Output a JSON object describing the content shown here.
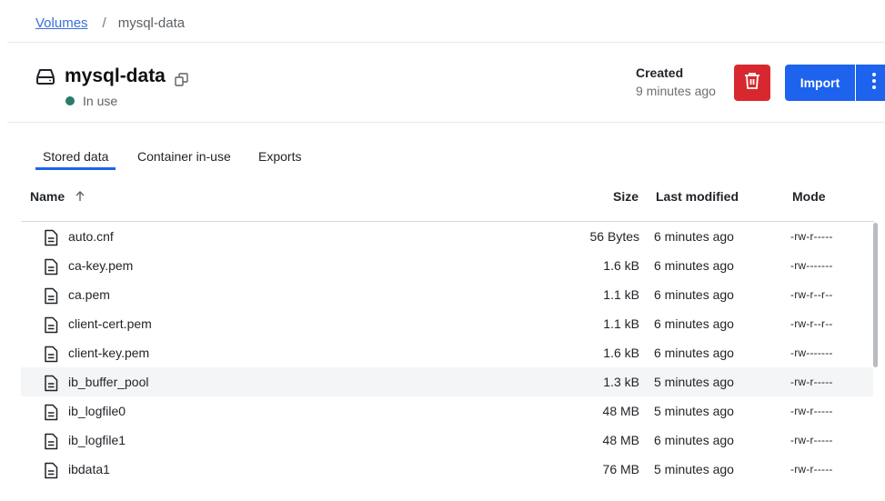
{
  "breadcrumb": {
    "root": "Volumes",
    "separator": "/",
    "current": "mysql-data"
  },
  "volume": {
    "name": "mysql-data",
    "status": "In use"
  },
  "created": {
    "label": "Created",
    "value": "9 minutes ago"
  },
  "actions": {
    "import_label": "Import"
  },
  "tabs": [
    {
      "label": "Stored data",
      "active": true
    },
    {
      "label": "Container in-use",
      "active": false
    },
    {
      "label": "Exports",
      "active": false
    }
  ],
  "table": {
    "columns": {
      "name": "Name",
      "size": "Size",
      "modified": "Last modified",
      "mode": "Mode"
    },
    "rows": [
      {
        "name": "auto.cnf",
        "size": "56 Bytes",
        "modified": "6 minutes ago",
        "mode": "-rw-r-----"
      },
      {
        "name": "ca-key.pem",
        "size": "1.6 kB",
        "modified": "6 minutes ago",
        "mode": "-rw-------"
      },
      {
        "name": "ca.pem",
        "size": "1.1 kB",
        "modified": "6 minutes ago",
        "mode": "-rw-r--r--"
      },
      {
        "name": "client-cert.pem",
        "size": "1.1 kB",
        "modified": "6 minutes ago",
        "mode": "-rw-r--r--"
      },
      {
        "name": "client-key.pem",
        "size": "1.6 kB",
        "modified": "6 minutes ago",
        "mode": "-rw-------"
      },
      {
        "name": "ib_buffer_pool",
        "size": "1.3 kB",
        "modified": "5 minutes ago",
        "mode": "-rw-r-----"
      },
      {
        "name": "ib_logfile0",
        "size": "48 MB",
        "modified": "5 minutes ago",
        "mode": "-rw-r-----"
      },
      {
        "name": "ib_logfile1",
        "size": "48 MB",
        "modified": "6 minutes ago",
        "mode": "-rw-r-----"
      },
      {
        "name": "ibdata1",
        "size": "76 MB",
        "modified": "5 minutes ago",
        "mode": "-rw-r-----"
      }
    ]
  },
  "colors": {
    "accent": "#1d63ed",
    "danger": "#d8282f",
    "status_green": "#2b7a6a"
  }
}
